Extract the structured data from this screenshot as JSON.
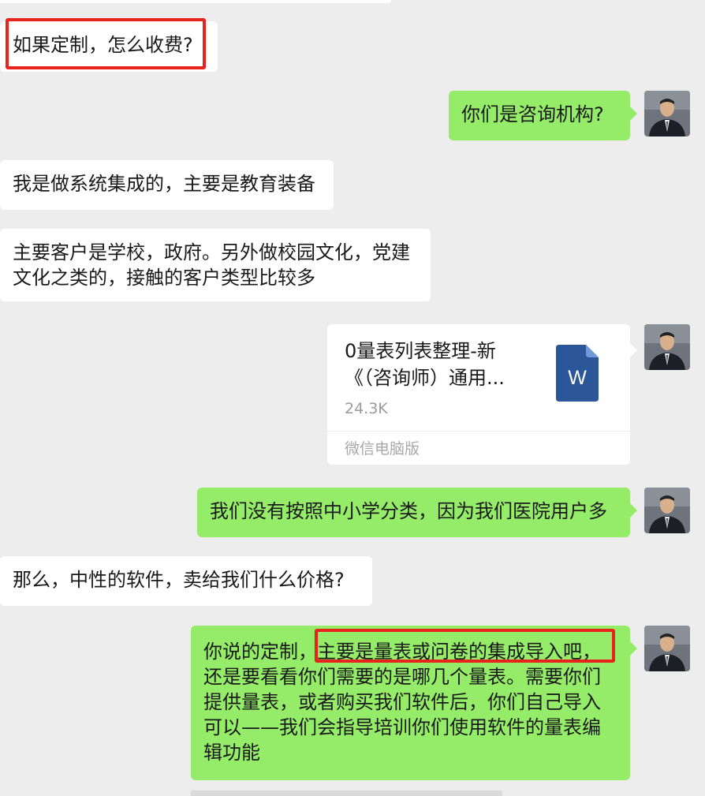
{
  "messages": [
    {
      "side": "left",
      "text": "如果定制，怎么收费?"
    },
    {
      "side": "right",
      "text": "你们是咨询机构?"
    },
    {
      "side": "left",
      "text": "我是做系统集成的，主要是教育装备"
    },
    {
      "side": "left",
      "lines": [
        "主要客户是学校，政府。另外做校园文化，党建",
        "文化之类的，接触的客户类型比较多"
      ]
    },
    {
      "side": "right",
      "text": "我们没有按照中小学分类，因为我们医院用户多"
    },
    {
      "side": "left",
      "text": "那么，中性的软件，卖给我们什么价格?"
    },
    {
      "side": "right",
      "lines": [
        "你说的定制，主要是量表或问卷的集成导入吧，",
        "还是要看看你们需要的是哪几个量表。需要你们",
        "提供量表，或者购买我们软件后，你们自己导入",
        "可以——我们会指导培训你们使用软件的量表编",
        "辑功能"
      ]
    }
  ],
  "file": {
    "name_line1": "0量表列表整理-新",
    "name_line2": "《（咨询师）通用...",
    "size": "24.3K",
    "source": "微信电脑版",
    "icon_letter": "W",
    "icon": "word-doc-icon"
  },
  "colors": {
    "background": "#ededed",
    "bubble_left": "#ffffff",
    "bubble_right": "#95ec69",
    "highlight": "#e8231b",
    "word_blue": "#2b579a"
  }
}
